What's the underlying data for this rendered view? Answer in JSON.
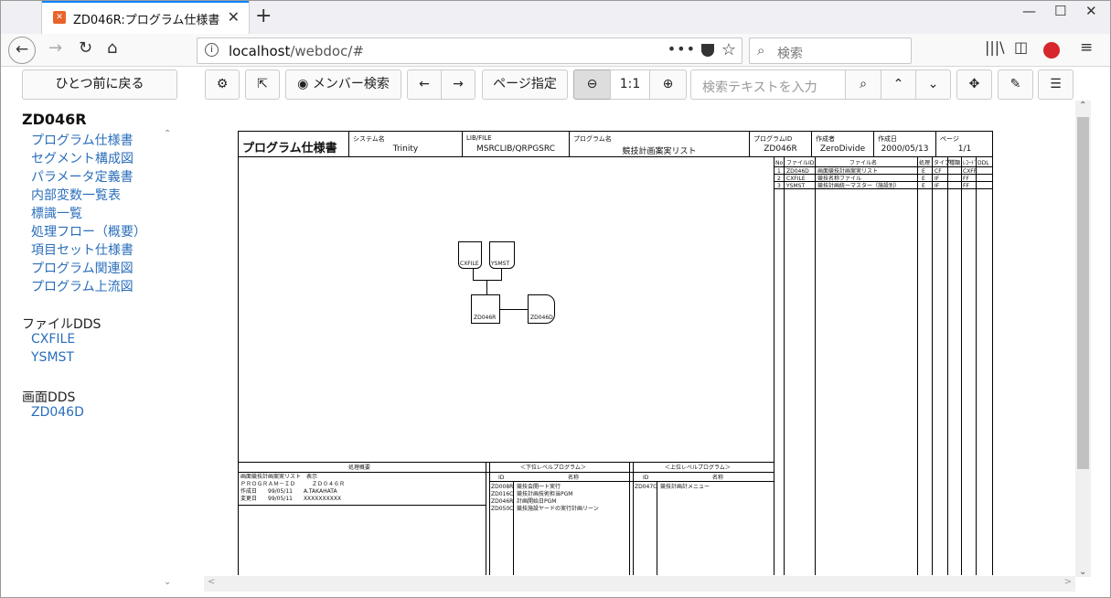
{
  "browser": {
    "tab_title": "ZD046R:プログラム仕様書",
    "url_host": "localhost",
    "url_path": "/webdoc/#",
    "search_placeholder": "検索"
  },
  "toolbar": {
    "prev_label": "ひとつ前に戻る",
    "member_search_label": "メンバー検索",
    "page_label": "ページ指定",
    "zoom_label": "1:1",
    "find_placeholder": "検索テキストを入力"
  },
  "sidebar": {
    "title": "ZD046R",
    "items": [
      "プログラム仕様書",
      "セグメント構成図",
      "パラメータ定義書",
      "内部変数一覧表",
      "標識一覧",
      "処理フロー（概要）",
      "項目セット仕様書",
      "プログラム関連図",
      "プログラム上流図"
    ],
    "file_section": "ファイルDDS",
    "files": [
      "CXFILE",
      "YSMST"
    ],
    "screen_section": "画面DDS",
    "screens": [
      "ZD046D"
    ]
  },
  "sheet": {
    "title": "プログラム仕様書",
    "h_system": "システム名",
    "v_system": "Trinity",
    "h_lib": "LIB/FILE",
    "v_lib": "MSRCLIB/QRPGSRC",
    "h_prog": "プログラム名",
    "v_prog": "競技計画案実リスト",
    "h_pid": "プログラムID",
    "v_pid": "ZD046R",
    "h_author": "作成者",
    "v_author": "ZeroDivide",
    "h_date": "作成日",
    "v_date": "2000/05/13",
    "h_page": "ページ",
    "v_page": "1/1",
    "diagram": {
      "f1": "CXFILE",
      "f2": "YSMST",
      "prog": "ZD046R",
      "disp": "ZD046D"
    },
    "file_rows": [
      [
        "1",
        "ZD046D",
        "画面競技計画案実リスト",
        "E",
        "CF",
        "",
        "CXFF"
      ],
      [
        "2",
        "CXFILE",
        "競技名称ファイル",
        "E",
        "IF",
        "",
        "FF"
      ],
      [
        "3",
        "YSMST",
        "競技計画統ーマスター（施設別）",
        "E",
        "IF",
        "",
        "FF"
      ]
    ],
    "file_head": [
      "No",
      "ファイルID",
      "ファイル名",
      "処理",
      "タイプ",
      "種類",
      "ﾚｺｰﾄﾞ",
      "DDL"
    ],
    "summary_head": "処理概要",
    "summary_lines": [
      "画面競技計画案実リスト　表示",
      "ＰＲＯＧＲＡＭ－ＩＤ　　　ＺＤ０４６Ｒ",
      "作成日　　99/05/11　　A.TAKAHATA",
      "変更日　　99/05/11　　XXXXXXXXXX"
    ],
    "lower_head": "＜下位レベルプログラム＞",
    "lower_cols": [
      "ID",
      "名称"
    ],
    "lower_rows": [
      [
        "ZD008R",
        "競技会開一ト実行"
      ],
      [
        "ZD016C",
        "競技計画技術担当PGM"
      ],
      [
        "ZD046R",
        "計画開始日PGM"
      ],
      [
        "ZD050C",
        "競技施設ヤードの実行計画リーン"
      ]
    ],
    "upper_head": "＜上位レベルプログラム＞",
    "upper_cols": [
      "ID",
      "名称"
    ],
    "upper_rows": [
      [
        "ZD047C",
        "競技計画計メニュー"
      ]
    ]
  }
}
